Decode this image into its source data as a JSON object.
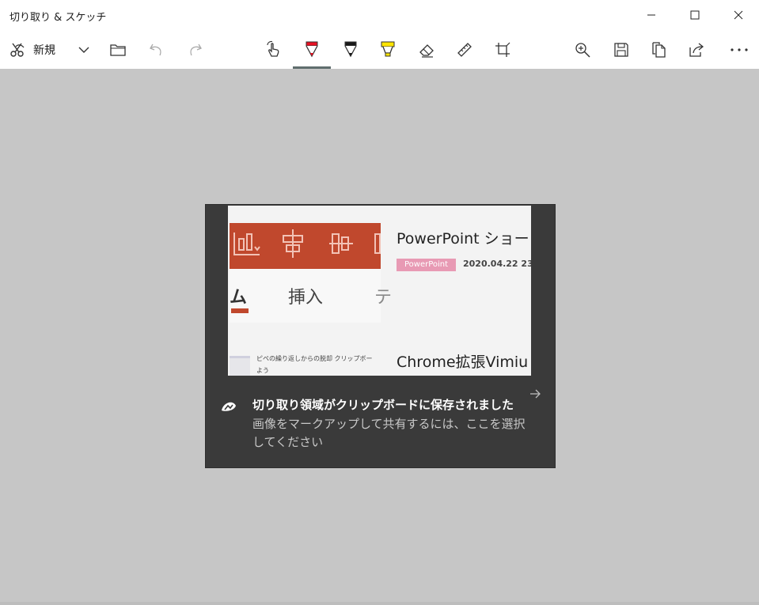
{
  "window": {
    "title": "切り取り & スケッチ"
  },
  "toolbar": {
    "new_label": "新規",
    "icons": [
      "new-snip-icon",
      "chevron-down-icon",
      "folder-icon",
      "undo-icon",
      "redo-icon",
      "touch-writing-icon",
      "ballpoint-pen-icon",
      "pencil-icon",
      "highlighter-icon",
      "eraser-icon",
      "ruler-icon",
      "crop-icon",
      "zoom-icon",
      "save-icon",
      "copy-icon",
      "share-icon",
      "more-icon"
    ],
    "colors": {
      "ballpoint": "#e81123",
      "pencil": "#1a1a1a",
      "highlighter": "#ffe500",
      "selected_underline": "#606e6e"
    }
  },
  "toast": {
    "title": "切り取り領域がクリップボードに保存されました",
    "body": "画像をマークアップして共有するには、ここを選択してください",
    "thumbnail": {
      "tab_home_partial": "ム",
      "tab_insert": "挿入",
      "tab_next_partial": "テ",
      "card1_title": "PowerPoint ショー",
      "card1_tag": "PowerPoint",
      "card1_date": "2020.04.22 23:",
      "mini_text_line1": "ピペの繰り返しからの脱却 クリップボー",
      "mini_text_line2": "よう",
      "card2_title": "Chrome拡張Vimiu",
      "ribbon_color": "#c0482d",
      "tag_color": "#e89ab4"
    }
  }
}
